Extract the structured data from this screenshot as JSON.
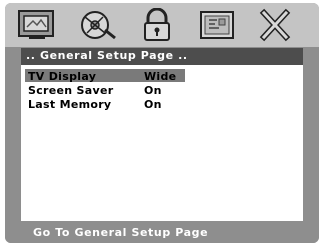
{
  "menu": {
    "icons": [
      "tv-icon",
      "disc-icon",
      "lock-icon",
      "settings-panel-icon",
      "close-icon"
    ],
    "title": ".. General Setup Page ..",
    "items": [
      {
        "label": "TV Display",
        "value": "Wide",
        "selected": true
      },
      {
        "label": "Screen Saver",
        "value": "On",
        "selected": false
      },
      {
        "label": "Last Memory",
        "value": "On",
        "selected": false
      }
    ],
    "status": "Go To General Setup Page"
  },
  "colors": {
    "frame": "#8e8e8e",
    "icon_bar": "#c4c4c4",
    "title_bar": "#4d4d4d",
    "selection": "#7a7a7a",
    "panel": "#ffffff"
  }
}
